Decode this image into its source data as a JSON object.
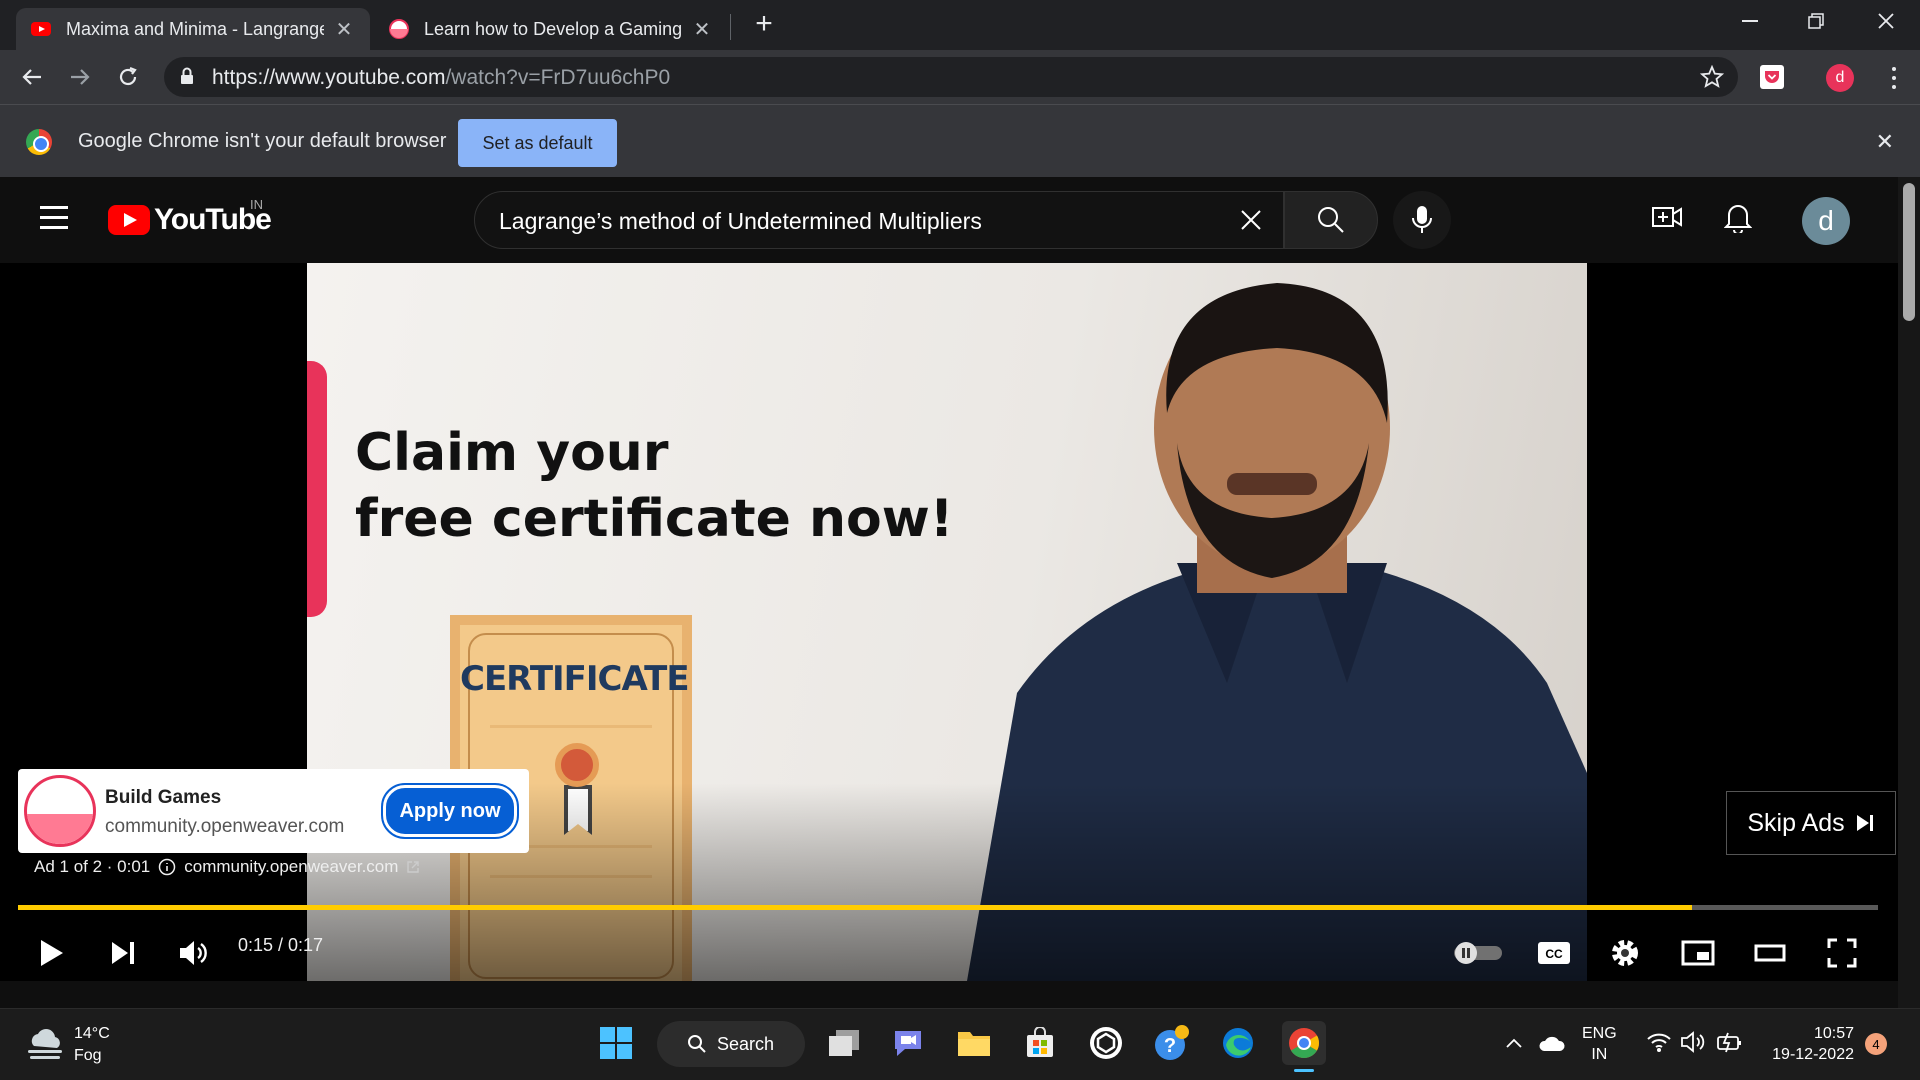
{
  "tabs": [
    {
      "title": "Maxima and Minima - Langrange",
      "active": true,
      "favicon": "youtube-icon"
    },
    {
      "title": "Learn how to Develop a Gaming",
      "active": false,
      "favicon": "openweaver-icon"
    }
  ],
  "omnibox": {
    "host": "https://www.youtube.com",
    "path": "/watch?v=FrD7uu6chP0"
  },
  "profile_initial": "d",
  "infobar": {
    "message": "Google Chrome isn't your default browser",
    "button": "Set as default"
  },
  "youtube": {
    "logo_text": "YouTube",
    "country": "IN",
    "search_query": "Lagrange’s method of Undetermined Multipliers",
    "avatar_initial": "d"
  },
  "video": {
    "headline_line1": "Claim your",
    "headline_line2": "free certificate now!",
    "certificate_label": "CERTIFICATE"
  },
  "ad": {
    "title": "Build Games",
    "domain": "community.openweaver.com",
    "cta": "Apply now",
    "counter": "Ad 1 of 2 · 0:01",
    "link": "community.openweaver.com",
    "skip": "Skip Ads"
  },
  "player": {
    "time": "0:15 / 0:17",
    "progress": 0.9
  },
  "taskbar": {
    "temp": "14°C",
    "condition": "Fog",
    "search_label": "Search",
    "lang_top": "ENG",
    "lang_bottom": "IN",
    "clock": "10:57",
    "date": "19-12-2022",
    "notifications": "4"
  },
  "colors": {
    "accent": "#ffcc00",
    "yt_red": "#ff0000",
    "cta_blue": "#065fd4",
    "chrome_bar": "#35363a"
  }
}
